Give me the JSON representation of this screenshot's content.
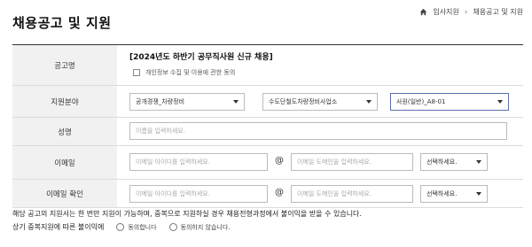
{
  "page": {
    "title": "채용공고 및 지원"
  },
  "breadcrumb": {
    "items": [
      "입사지원",
      "채용공고 및 지원"
    ],
    "separator": "›"
  },
  "form": {
    "posting": {
      "label": "공고명",
      "title": "[2024년도 하반기 공무직사원 신규 채용]",
      "consent_label": "개인정보 수집 및 이용에 관한 동의"
    },
    "field": {
      "label": "지원분야",
      "select1": "공개경쟁_차량정비",
      "select2": "수도단철도차량정비사업소",
      "select3": "사원(일반)_A8-01"
    },
    "name": {
      "label": "성명",
      "placeholder": "이름을 입력하세요."
    },
    "email": {
      "label": "이메일",
      "id_placeholder": "이메일 아이디를 입력하세요.",
      "at": "@",
      "domain_placeholder": "이메일 도메인을 입력하세요.",
      "select_placeholder": "선택하세요."
    },
    "email_confirm": {
      "label": "이메일 확인",
      "id_placeholder": "이메일 아이디를 입력하세요.",
      "at": "@",
      "domain_placeholder": "이메일 도메인을 입력하세요.",
      "select_placeholder": "선택하세요."
    }
  },
  "notice": {
    "text": "해당 공고의 지원서는 한 번만 지원이 가능하며, 중복으로 지원하실 경우 채용전형과정에서 불이익을 받을 수 있습니다.",
    "agree_label": "상기 중복지원에 따른 불이익에",
    "agree_yes": "동의합니다",
    "agree_no": "동의하지 않습니다."
  },
  "colors": {
    "label_bg": "#f1f1f1",
    "active_border": "#5a6fb0",
    "border": "#bbbbbb"
  }
}
